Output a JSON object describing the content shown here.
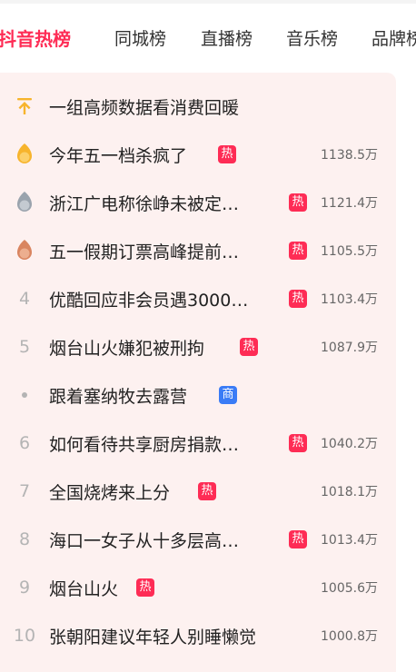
{
  "tabs": [
    {
      "label": "抖音热榜",
      "active": true
    },
    {
      "label": "同城榜",
      "active": false
    },
    {
      "label": "直播榜",
      "active": false
    },
    {
      "label": "音乐榜",
      "active": false
    },
    {
      "label": "品牌榜",
      "active": false
    }
  ],
  "list": {
    "pinned": {
      "title": "一组高频数据看消费回暖"
    },
    "items": [
      {
        "rank": "1",
        "title": "今年五一档杀疯了",
        "badge": "热",
        "heat": "1138.5万"
      },
      {
        "rank": "2",
        "title": "浙江广电称徐峥未被定…",
        "badge": "热",
        "heat": "1121.4万"
      },
      {
        "rank": "3",
        "title": "五一假期订票高峰提前…",
        "badge": "热",
        "heat": "1105.5万"
      },
      {
        "rank": "4",
        "title": "优酷回应非会员遇3000…",
        "badge": "热",
        "heat": "1103.4万"
      },
      {
        "rank": "5",
        "title": "烟台山火嫌犯被刑拘",
        "badge": "热",
        "heat": "1087.9万"
      },
      {
        "rank": "",
        "title": "跟着塞纳牧去露营",
        "badge": "商",
        "heat": ""
      },
      {
        "rank": "6",
        "title": "如何看待共享厨房捐款…",
        "badge": "热",
        "heat": "1040.2万"
      },
      {
        "rank": "7",
        "title": "全国烧烤来上分",
        "badge": "热",
        "heat": "1018.1万"
      },
      {
        "rank": "8",
        "title": "海口一女子从十多层高…",
        "badge": "热",
        "heat": "1013.4万"
      },
      {
        "rank": "9",
        "title": "烟台山火",
        "badge": "热",
        "heat": "1005.6万"
      },
      {
        "rank": "10",
        "title": "张朝阳建议年轻人别睡懒觉",
        "badge": "",
        "heat": "1000.8万"
      }
    ]
  },
  "colors": {
    "accent": "#fe2c55",
    "panel_bg": "#fdf1f0",
    "gold": "#f7b42c",
    "silver": "#9aa3ad",
    "bronze": "#d98560",
    "pin": "#f7b42c",
    "shang": "#3a7cf6"
  },
  "icons": {
    "pinned": "pin-top-icon",
    "rank1": "gold-medal-icon",
    "rank2": "silver-medal-icon",
    "rank3": "bronze-medal-icon",
    "ad": "dot-icon"
  }
}
